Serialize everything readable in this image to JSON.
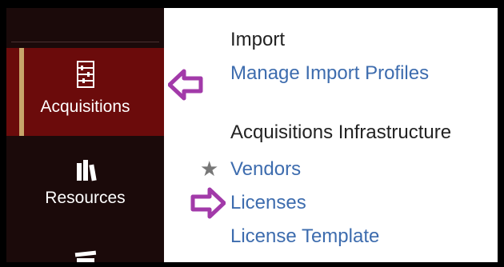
{
  "sidebar": {
    "items": [
      {
        "label": "Acquisitions",
        "icon": "abacus-icon",
        "active": true
      },
      {
        "label": "Resources",
        "icon": "books-icon",
        "active": false
      },
      {
        "label": "",
        "icon": "stack-icon",
        "active": false
      }
    ]
  },
  "menu": {
    "sections": [
      {
        "heading": "Import",
        "links": [
          {
            "label": "Manage Import Profiles"
          }
        ]
      },
      {
        "heading": "Acquisitions Infrastructure",
        "links": [
          {
            "label": "Vendors",
            "favorite": true
          },
          {
            "label": "Licenses"
          },
          {
            "label": "License Template"
          }
        ]
      }
    ]
  },
  "annotations": {
    "arrow_color": "#a23aa9"
  },
  "colors": {
    "sidebar_bg": "#1b0a0a",
    "active_bg": "#6b0b0b",
    "accent": "#c8a56a",
    "link": "#3d6cae"
  }
}
